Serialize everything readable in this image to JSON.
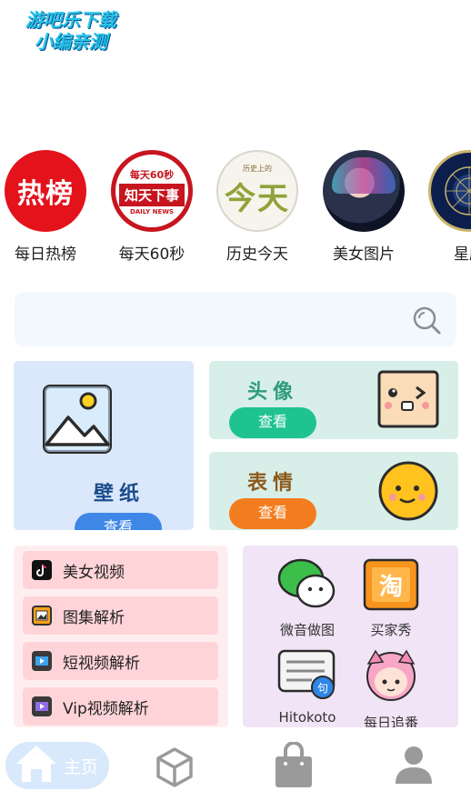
{
  "watermark": {
    "line1": "游吧乐下载",
    "line2": "小编亲测"
  },
  "shortcuts": [
    {
      "label": "每日热榜",
      "badge": "热榜"
    },
    {
      "label": "每天60秒",
      "badge_top": "每天60秒",
      "badge_mid": "知天下事",
      "badge_bot": "DAILY NEWS"
    },
    {
      "label": "历史今天",
      "badge_top": "历史上的",
      "badge_mid": "今天"
    },
    {
      "label": "美女图片"
    },
    {
      "label": "星座"
    }
  ],
  "search": {
    "placeholder": "",
    "icon": "search-icon"
  },
  "wallpaper": {
    "title": "壁纸",
    "button": "查看"
  },
  "avatar": {
    "title": "头像",
    "button": "查看",
    "accent": "#1fc38f"
  },
  "emoji": {
    "title": "表情",
    "button": "查看",
    "accent": "#f37d1e"
  },
  "parse_list": [
    {
      "label": "美女视频",
      "icon": "tiktok-icon"
    },
    {
      "label": "图集解析",
      "icon": "gallery-icon"
    },
    {
      "label": "短视频解析",
      "icon": "film-icon"
    },
    {
      "label": "Vip视频解析",
      "icon": "vip-film-icon"
    }
  ],
  "grid": [
    {
      "label": "微音做图",
      "icon": "wechat-icon"
    },
    {
      "label": "买家秀",
      "icon": "taobao-icon"
    },
    {
      "label": "Hitokoto",
      "icon": "quote-icon"
    },
    {
      "label": "每日追番",
      "icon": "anime-icon"
    }
  ],
  "nav": [
    {
      "label": "主页",
      "icon": "home-icon",
      "active": true
    },
    {
      "label": "",
      "icon": "cube-icon"
    },
    {
      "label": "",
      "icon": "bag-icon"
    },
    {
      "label": "",
      "icon": "user-icon"
    }
  ]
}
